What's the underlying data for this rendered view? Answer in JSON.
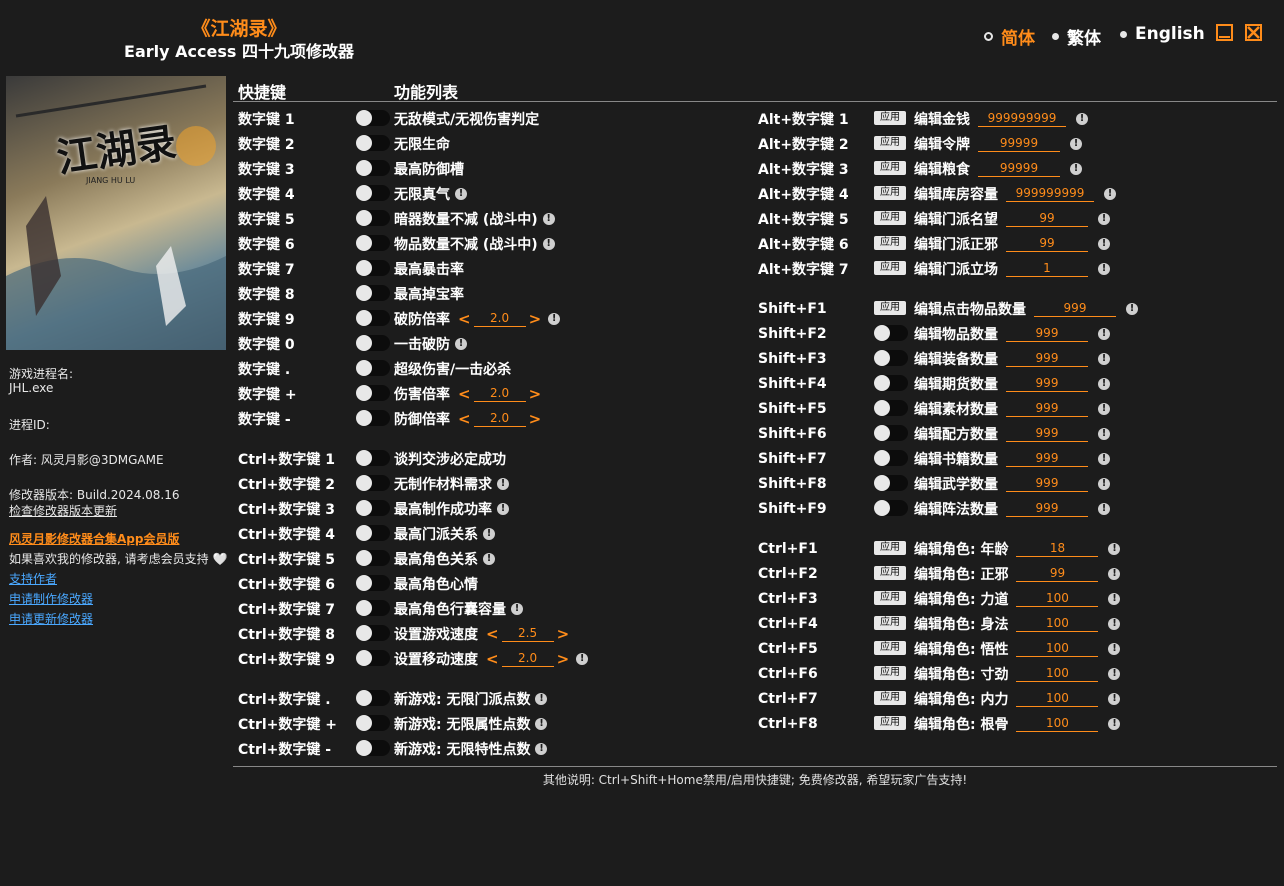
{
  "header": {
    "title": "《江湖录》",
    "subtitle": "Early Access 四十九项修改器"
  },
  "languages": [
    {
      "label": "简体",
      "selected": true
    },
    {
      "label": "繁体",
      "selected": false
    },
    {
      "label": "English",
      "selected": false
    }
  ],
  "columns": {
    "hotkey": "快捷键",
    "features": "功能列表"
  },
  "cover": {
    "title": "江湖录",
    "subtitle": "JIANG HU LU"
  },
  "sidebar": {
    "process_label": "游戏进程名:",
    "process_name": "JHL.exe",
    "process_id_label": "进程ID:",
    "author": "作者: 风灵月影@3DMGAME",
    "version": "修改器版本: Build.2024.08.16",
    "check_update": "检查修改器版本更新",
    "app_promo": "风灵月影修改器合集App会员版",
    "support_text": "如果喜欢我的修改器, 请考虑会员支持 🤍",
    "links": [
      "支持作者",
      "申请制作修改器",
      "申请更新修改器"
    ]
  },
  "left_rows": [
    {
      "key": "数字键 1",
      "label": "无敌模式/无视伤害判定",
      "info": false
    },
    {
      "key": "数字键 2",
      "label": "无限生命",
      "info": false
    },
    {
      "key": "数字键 3",
      "label": "最高防御槽",
      "info": false
    },
    {
      "key": "数字键 4",
      "label": "无限真气",
      "info": true
    },
    {
      "key": "数字键 5",
      "label": "暗器数量不减 (战斗中)",
      "info": true
    },
    {
      "key": "数字键 6",
      "label": "物品数量不减 (战斗中)",
      "info": true
    },
    {
      "key": "数字键 7",
      "label": "最高暴击率",
      "info": false
    },
    {
      "key": "数字键 8",
      "label": "最高掉宝率",
      "info": false
    },
    {
      "key": "数字键 9",
      "label": "破防倍率",
      "info": true,
      "value": "2.0"
    },
    {
      "key": "数字键 0",
      "label": "一击破防",
      "info": true
    },
    {
      "key": "数字键 .",
      "label": "超级伤害/一击必杀",
      "info": false
    },
    {
      "key": "数字键 +",
      "label": "伤害倍率",
      "info": false,
      "value": "2.0"
    },
    {
      "key": "数字键 -",
      "label": "防御倍率",
      "info": false,
      "value": "2.0"
    },
    {
      "key": "Ctrl+数字键 1",
      "label": "谈判交涉必定成功",
      "info": false
    },
    {
      "key": "Ctrl+数字键 2",
      "label": "无制作材料需求",
      "info": true
    },
    {
      "key": "Ctrl+数字键 3",
      "label": "最高制作成功率",
      "info": true
    },
    {
      "key": "Ctrl+数字键 4",
      "label": "最高门派关系",
      "info": true
    },
    {
      "key": "Ctrl+数字键 5",
      "label": "最高角色关系",
      "info": true
    },
    {
      "key": "Ctrl+数字键 6",
      "label": "最高角色心情",
      "info": false
    },
    {
      "key": "Ctrl+数字键 7",
      "label": "最高角色行囊容量",
      "info": true
    },
    {
      "key": "Ctrl+数字键 8",
      "label": "设置游戏速度",
      "info": false,
      "value": "2.5"
    },
    {
      "key": "Ctrl+数字键 9",
      "label": "设置移动速度",
      "info": true,
      "value": "2.0"
    },
    {
      "key": "Ctrl+数字键 .",
      "label": "新游戏: 无限门派点数",
      "info": true
    },
    {
      "key": "Ctrl+数字键 +",
      "label": "新游戏: 无限属性点数",
      "info": true
    },
    {
      "key": "Ctrl+数字键 -",
      "label": "新游戏: 无限特性点数",
      "info": true
    }
  ],
  "right_rows": [
    {
      "key": "Alt+数字键 1",
      "control": "apply",
      "label": "编辑金钱",
      "value": "999999999"
    },
    {
      "key": "Alt+数字键 2",
      "control": "apply",
      "label": "编辑令牌",
      "value": "99999"
    },
    {
      "key": "Alt+数字键 3",
      "control": "apply",
      "label": "编辑粮食",
      "value": "99999"
    },
    {
      "key": "Alt+数字键 4",
      "control": "apply",
      "label": "编辑库房容量",
      "value": "999999999"
    },
    {
      "key": "Alt+数字键 5",
      "control": "apply",
      "label": "编辑门派名望",
      "value": "99"
    },
    {
      "key": "Alt+数字键 6",
      "control": "apply",
      "label": "编辑门派正邪",
      "value": "99"
    },
    {
      "key": "Alt+数字键 7",
      "control": "apply",
      "label": "编辑门派立场",
      "value": "1"
    },
    {
      "key": "Shift+F1",
      "control": "apply",
      "label": "编辑点击物品数量",
      "value": "999"
    },
    {
      "key": "Shift+F2",
      "control": "toggle",
      "label": "编辑物品数量",
      "value": "999"
    },
    {
      "key": "Shift+F3",
      "control": "toggle",
      "label": "编辑装备数量",
      "value": "999"
    },
    {
      "key": "Shift+F4",
      "control": "toggle",
      "label": "编辑期货数量",
      "value": "999"
    },
    {
      "key": "Shift+F5",
      "control": "toggle",
      "label": "编辑素材数量",
      "value": "999"
    },
    {
      "key": "Shift+F6",
      "control": "toggle",
      "label": "编辑配方数量",
      "value": "999"
    },
    {
      "key": "Shift+F7",
      "control": "toggle",
      "label": "编辑书籍数量",
      "value": "999"
    },
    {
      "key": "Shift+F8",
      "control": "toggle",
      "label": "编辑武学数量",
      "value": "999"
    },
    {
      "key": "Shift+F9",
      "control": "toggle",
      "label": "编辑阵法数量",
      "value": "999"
    },
    {
      "key": "Ctrl+F1",
      "control": "apply",
      "label": "编辑角色: 年龄",
      "value": "18"
    },
    {
      "key": "Ctrl+F2",
      "control": "apply",
      "label": "编辑角色: 正邪",
      "value": "99"
    },
    {
      "key": "Ctrl+F3",
      "control": "apply",
      "label": "编辑角色: 力道",
      "value": "100"
    },
    {
      "key": "Ctrl+F4",
      "control": "apply",
      "label": "编辑角色: 身法",
      "value": "100"
    },
    {
      "key": "Ctrl+F5",
      "control": "apply",
      "label": "编辑角色: 悟性",
      "value": "100"
    },
    {
      "key": "Ctrl+F6",
      "control": "apply",
      "label": "编辑角色: 寸劲",
      "value": "100"
    },
    {
      "key": "Ctrl+F7",
      "control": "apply",
      "label": "编辑角色: 内力",
      "value": "100"
    },
    {
      "key": "Ctrl+F8",
      "control": "apply",
      "label": "编辑角色: 根骨",
      "value": "100"
    }
  ],
  "apply_label": "应用",
  "footer": "其他说明: Ctrl+Shift+Home禁用/启用快捷键; 免费修改器, 希望玩家广告支持!",
  "colors": {
    "accent": "#ff8c1a",
    "background": "#1c1c1c",
    "link": "#4aa8ff"
  }
}
